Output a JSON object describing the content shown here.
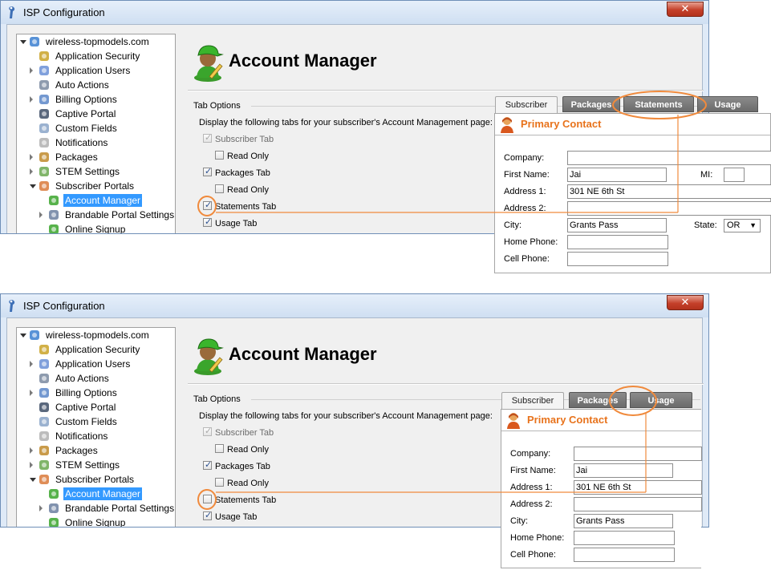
{
  "window": {
    "title": "ISP Configuration",
    "close_label": "✕"
  },
  "tree": {
    "items": [
      {
        "label": "wireless-topmodels.com",
        "icon": "globe-icon",
        "level": 0,
        "expander": "open",
        "selected": false
      },
      {
        "label": "Application Security",
        "icon": "key-icon",
        "level": 1,
        "expander": "none",
        "selected": false
      },
      {
        "label": "Application Users",
        "icon": "users-icon",
        "level": 1,
        "expander": "closed",
        "selected": false
      },
      {
        "label": "Auto Actions",
        "icon": "clock-icon",
        "level": 1,
        "expander": "none",
        "selected": false
      },
      {
        "label": "Billing Options",
        "icon": "billing-icon",
        "level": 1,
        "expander": "closed",
        "selected": false
      },
      {
        "label": "Captive Portal",
        "icon": "monitor-icon",
        "level": 1,
        "expander": "none",
        "selected": false
      },
      {
        "label": "Custom Fields",
        "icon": "edit-form-icon",
        "level": 1,
        "expander": "none",
        "selected": false
      },
      {
        "label": "Notifications",
        "icon": "notification-icon",
        "level": 1,
        "expander": "none",
        "selected": false
      },
      {
        "label": "Packages",
        "icon": "package-icon",
        "level": 1,
        "expander": "closed",
        "selected": false
      },
      {
        "label": "STEM Settings",
        "icon": "stem-icon",
        "level": 1,
        "expander": "closed",
        "selected": false
      },
      {
        "label": "Subscriber Portals",
        "icon": "portal-users-icon",
        "level": 1,
        "expander": "open",
        "selected": false
      },
      {
        "label": "Account Manager",
        "icon": "account-manager-icon",
        "level": 2,
        "expander": "none",
        "selected": true
      },
      {
        "label": "Brandable Portal Settings",
        "icon": "document-icon",
        "level": 2,
        "expander": "closed",
        "selected": false
      },
      {
        "label": "Online Signup",
        "icon": "signup-icon",
        "level": 2,
        "expander": "none",
        "selected": false
      }
    ]
  },
  "page_title": "Account Manager",
  "tab_options": {
    "title": "Tab Options",
    "description": "Display the following tabs for your subscriber's Account Management page:",
    "subscriber_tab": "Subscriber Tab",
    "packages_tab": "Packages Tab",
    "read_only": "Read Only",
    "statements_tab": "Statements Tab",
    "usage_tab": "Usage Tab"
  },
  "preview": {
    "tabs": {
      "subscriber": "Subscriber",
      "packages": "Packages",
      "statements": "Statements",
      "usage": "Usage"
    },
    "contact_title": "Primary Contact",
    "labels": {
      "company": "Company:",
      "first_name": "First Name:",
      "mi": "MI:",
      "address1": "Address 1:",
      "address2": "Address 2:",
      "city": "City:",
      "state": "State:",
      "home_phone": "Home Phone:",
      "cell_phone": "Cell Phone:"
    },
    "values": {
      "first_name": "Jai",
      "address1": "301 NE 6th St",
      "city": "Grants Pass",
      "state": "OR"
    }
  },
  "screenshots": [
    {
      "statements_checked": true
    },
    {
      "statements_checked": false
    }
  ],
  "colors": {
    "accent_orange": "#e8731c",
    "selection": "#3399ff",
    "window_frame": "#dfeaf7"
  }
}
